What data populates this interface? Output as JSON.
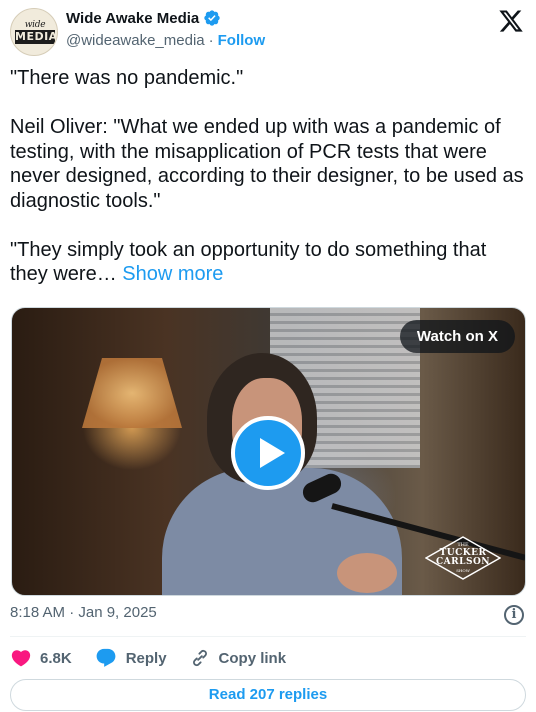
{
  "author": {
    "display_name": "Wide Awake Media",
    "handle": "@wideawake_media",
    "separator": "·",
    "follow_label": "Follow",
    "avatar_text_top": "wide awake",
    "avatar_text_box": "MEDIA",
    "verified_color": "#1d9bf0"
  },
  "tweet": {
    "paragraphs": [
      "\"There was no pandemic.\"",
      "Neil Oliver: \"What we ended up with was a pandemic of testing, with the misapplication of PCR tests that were never designed, according to their designer, to be used as diagnostic tools.\"",
      "\"They simply took an opportunity to do something that they were…"
    ],
    "show_more_label": "Show more"
  },
  "media": {
    "watch_label": "Watch on X",
    "show_logo": [
      "THE",
      "TUCKER",
      "CARLSON",
      "SHOW"
    ]
  },
  "meta": {
    "timestamp": "8:18 AM · Jan 9, 2025",
    "info_icon": "i"
  },
  "actions": {
    "likes": "6.8K",
    "reply_label": "Reply",
    "copy_link_label": "Copy link"
  },
  "read_replies_label": "Read 207 replies",
  "colors": {
    "accent": "#1d9bf0",
    "like": "#f91880",
    "secondary_text": "#536471"
  }
}
